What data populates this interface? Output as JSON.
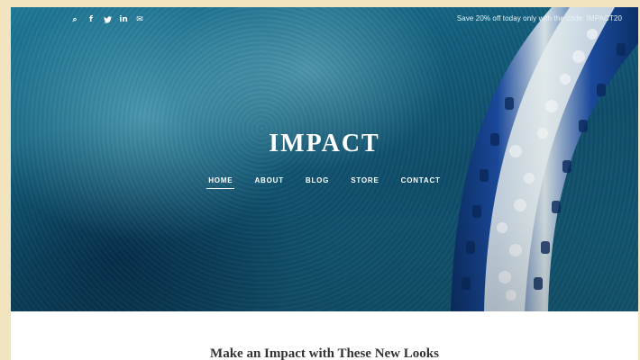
{
  "topbar": {
    "social_icons": [
      {
        "name": "search-icon",
        "glyph": "⌕"
      },
      {
        "name": "facebook-icon",
        "glyph": "f"
      },
      {
        "name": "twitter-icon",
        "glyph": "🐦"
      },
      {
        "name": "linkedin-icon",
        "glyph": "in"
      },
      {
        "name": "email-icon",
        "glyph": "✉"
      }
    ],
    "promo_text": "Save 20% off today only with the code: IMPACT20"
  },
  "header": {
    "site_title": "IMPACT"
  },
  "nav": {
    "items": [
      {
        "label": "HOME",
        "active": true
      },
      {
        "label": "ABOUT",
        "active": false
      },
      {
        "label": "BLOG",
        "active": false
      },
      {
        "label": "STORE",
        "active": false
      },
      {
        "label": "CONTACT",
        "active": false
      }
    ]
  },
  "main": {
    "heading": "Make an Impact with These New Looks"
  },
  "colors": {
    "hero_water": "#13607e",
    "text_light": "#ffffff",
    "page_border": "#f3e4c0",
    "heading_text": "#333333"
  }
}
